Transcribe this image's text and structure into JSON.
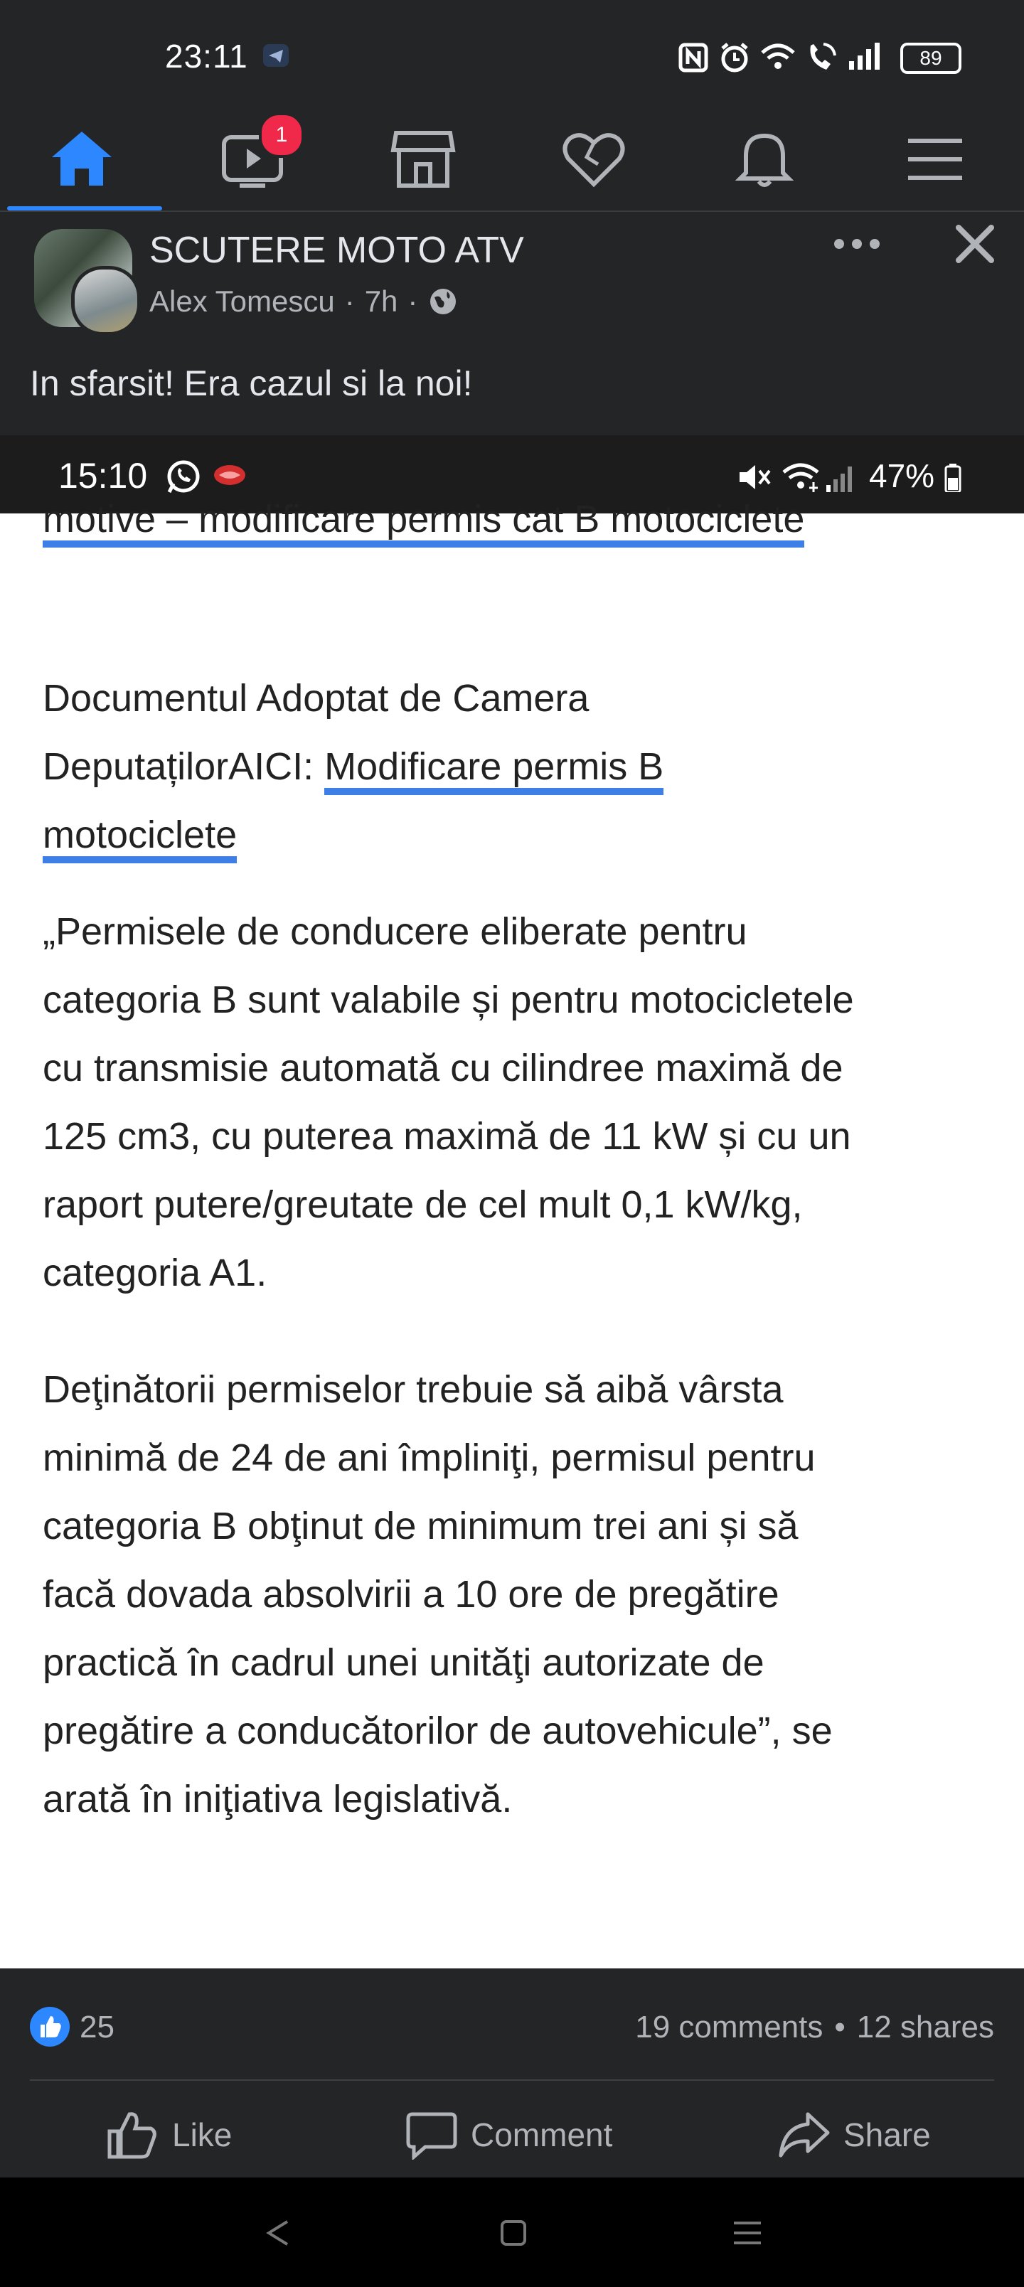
{
  "status_bar": {
    "time": "23:11",
    "battery": "89",
    "icons": [
      "telegram-icon",
      "nfc-icon",
      "alarm-icon",
      "wifi-icon",
      "wifi-call-icon",
      "signal-icon",
      "battery-icon"
    ]
  },
  "nav": {
    "items": [
      {
        "name": "home",
        "icon": "home-icon",
        "active": true
      },
      {
        "name": "watch",
        "icon": "video-icon",
        "badge": "1"
      },
      {
        "name": "marketplace",
        "icon": "store-icon"
      },
      {
        "name": "dating",
        "icon": "heart-icon"
      },
      {
        "name": "notifications",
        "icon": "bell-icon"
      },
      {
        "name": "menu",
        "icon": "menu-icon"
      }
    ],
    "accent": "#2d88ff"
  },
  "post": {
    "group_name": "SCUTERE MOTO ATV",
    "author": "Alex Tomescu",
    "time": "7h",
    "separator": "·",
    "text": "In sfarsit! Era cazul si la noi!"
  },
  "shared_image": {
    "status_time": "15:10",
    "status_battery": "47%",
    "cut_line": "motive – modificare permis cat B motociclete",
    "doc_line1": "Documentul  Adoptat de Camera",
    "doc_line2_prefix": "DeputațilorAICI: ",
    "doc_link_part1": "Modificare permis B",
    "doc_link_part2": "motociclete",
    "para1": "„Permisele de conducere eliberate pentru categoria B sunt valabile și pentru motocicletele cu transmisie automată cu cilindree maximă de 125 cm3, cu puterea maximă de 11 kW și cu un raport putere/greutate de cel mult 0,1 kW/kg, categoria A1.",
    "para1_lines": [
      "„Permisele de conducere eliberate pentru",
      "categoria B sunt valabile și pentru motocicletele",
      "cu transmisie automată cu cilindree maximă de",
      "125 cm3, cu puterea maximă de 11 kW și cu un",
      "raport putere/greutate de cel mult 0,1 kW/kg,",
      "categoria A1."
    ],
    "para2_lines": [
      "Deţinătorii permiselor trebuie să aibă vârsta",
      "minimă de 24 de ani împliniţi, permisul pentru",
      "categoria B obţinut de minimum trei ani și să",
      "facă dovada absolvirii a 10 ore de pregătire",
      "practică în cadrul unei unităţi autorizate de",
      "pregătire a conducătorilor de autovehicule”, se",
      "arată în iniţiativa legislativă."
    ]
  },
  "reactions": {
    "likes": "25",
    "comments": "19 comments",
    "dot": "•",
    "shares": "12 shares"
  },
  "actions": {
    "like": "Like",
    "comment": "Comment",
    "share": "Share"
  }
}
